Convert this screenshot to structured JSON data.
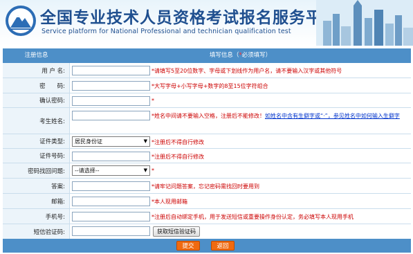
{
  "header": {
    "title_cn": "全国专业技术人员资格考试报名服务平台",
    "title_en": "Service platform for National Professional and technician  qualification test",
    "logo_icon": "mountain-logo-icon"
  },
  "table_head": {
    "left": "注册信息",
    "right_prefix": "填写信息（",
    "right_star": "*",
    "right_suffix": "必须填写）"
  },
  "rows": {
    "username": {
      "label": "用 户 名:",
      "hint": "*请填写5至20位数字、字母或下划线作为用户名，请不要输入汉字或其他符号"
    },
    "password": {
      "label": "密　　码:",
      "hint": "*大写字母+小写字母+数字的8至15位字符组合"
    },
    "confirm": {
      "label": "确认密码:",
      "hint": "*"
    },
    "name": {
      "label": "考生姓名:",
      "hint": "*姓名中间请不要输入空格，注册后不能修改！",
      "link": "如姓名中含有生僻字或“·”，参见姓名中如何输入生僻字"
    },
    "id_type": {
      "label": "证件类型:",
      "selected": "居民身份证",
      "hint": "*注册后不得自行修改"
    },
    "id_number": {
      "label": "证件号码:",
      "hint": "*注册后不得自行修改"
    },
    "question": {
      "label": "密码找回问题:",
      "selected": "--请选择--",
      "hint": "*"
    },
    "answer": {
      "label": "答案:",
      "hint": "*请牢记问题答案，忘记密码需找回时要用到"
    },
    "email": {
      "label": "邮箱:",
      "hint": "*本人现用邮箱"
    },
    "phone": {
      "label": "手机号:",
      "hint": "*注册后自动绑定手机，用于发送短信或重要操作身份认定，务必填写本人现用手机"
    },
    "sms": {
      "label": "短信验证码:",
      "button": "获取短信验证码"
    }
  },
  "actions": {
    "submit": "提交",
    "back": "返回"
  },
  "colors": {
    "header_bar": "#4d8fc8",
    "hint_red": "#cc0000",
    "button_orange": "#f06a10",
    "title_blue": "#1f4f8f"
  }
}
